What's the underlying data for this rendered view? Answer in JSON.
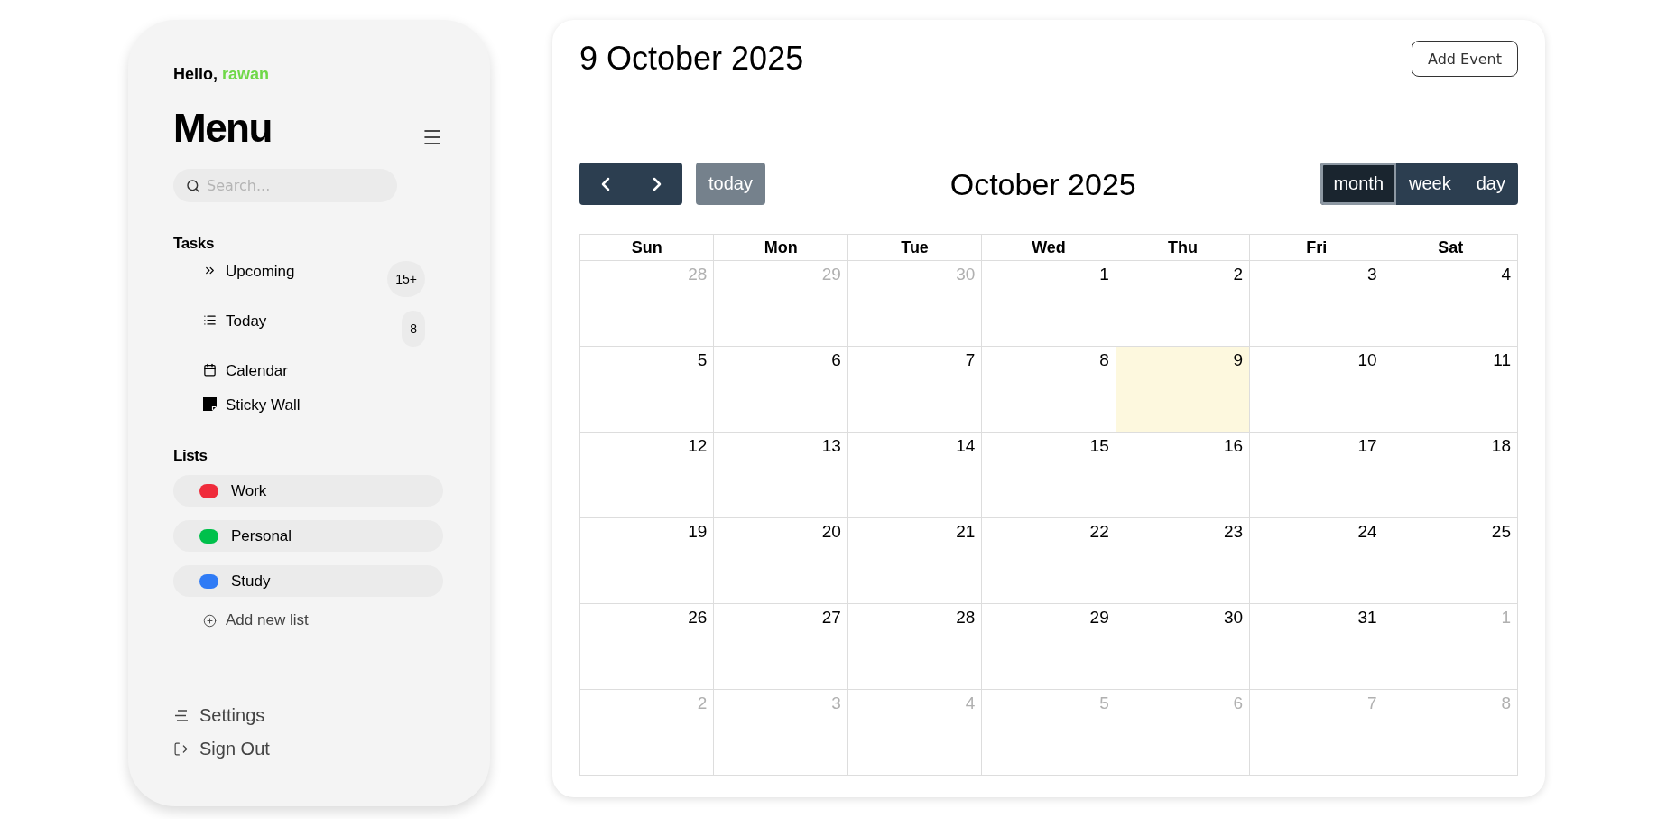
{
  "sidebar": {
    "greeting": {
      "text": "Hello,",
      "name": "rawan"
    },
    "title": "Menu",
    "search": {
      "placeholder": "Search..."
    },
    "tasks": {
      "heading": "Tasks",
      "items": [
        {
          "label": "Upcoming",
          "badge": "15+"
        },
        {
          "label": "Today",
          "badge": "8"
        },
        {
          "label": "Calendar"
        },
        {
          "label": "Sticky Wall"
        }
      ]
    },
    "lists": {
      "heading": "Lists",
      "items": [
        {
          "label": "Work",
          "color": "#ef2b3b"
        },
        {
          "label": "Personal",
          "color": "#00c04b"
        },
        {
          "label": "Study",
          "color": "#2f7bf5"
        }
      ],
      "add_label": "Add new list"
    },
    "footer": [
      {
        "label": "Settings"
      },
      {
        "label": "Sign Out"
      }
    ]
  },
  "header": {
    "date_title": "9 October 2025",
    "add_button": "Add Event"
  },
  "calendar": {
    "today_button": {
      "label": "today",
      "disabled": true
    },
    "title": "October 2025",
    "views": [
      {
        "label": "month",
        "selected": true
      },
      {
        "label": "week",
        "selected": false
      },
      {
        "label": "day",
        "selected": false
      }
    ],
    "weekdays": [
      "Sun",
      "Mon",
      "Tue",
      "Wed",
      "Thu",
      "Fri",
      "Sat"
    ],
    "weeks": [
      [
        {
          "day": "28",
          "outside_month": true,
          "is_today": false
        },
        {
          "day": "29",
          "outside_month": true,
          "is_today": false
        },
        {
          "day": "30",
          "outside_month": true,
          "is_today": false
        },
        {
          "day": "1",
          "outside_month": false,
          "is_today": false
        },
        {
          "day": "2",
          "outside_month": false,
          "is_today": false
        },
        {
          "day": "3",
          "outside_month": false,
          "is_today": false
        },
        {
          "day": "4",
          "outside_month": false,
          "is_today": false
        }
      ],
      [
        {
          "day": "5",
          "outside_month": false,
          "is_today": false
        },
        {
          "day": "6",
          "outside_month": false,
          "is_today": false
        },
        {
          "day": "7",
          "outside_month": false,
          "is_today": false
        },
        {
          "day": "8",
          "outside_month": false,
          "is_today": false
        },
        {
          "day": "9",
          "outside_month": false,
          "is_today": true
        },
        {
          "day": "10",
          "outside_month": false,
          "is_today": false
        },
        {
          "day": "11",
          "outside_month": false,
          "is_today": false
        }
      ],
      [
        {
          "day": "12",
          "outside_month": false,
          "is_today": false
        },
        {
          "day": "13",
          "outside_month": false,
          "is_today": false
        },
        {
          "day": "14",
          "outside_month": false,
          "is_today": false
        },
        {
          "day": "15",
          "outside_month": false,
          "is_today": false
        },
        {
          "day": "16",
          "outside_month": false,
          "is_today": false
        },
        {
          "day": "17",
          "outside_month": false,
          "is_today": false
        },
        {
          "day": "18",
          "outside_month": false,
          "is_today": false
        }
      ],
      [
        {
          "day": "19",
          "outside_month": false,
          "is_today": false
        },
        {
          "day": "20",
          "outside_month": false,
          "is_today": false
        },
        {
          "day": "21",
          "outside_month": false,
          "is_today": false
        },
        {
          "day": "22",
          "outside_month": false,
          "is_today": false
        },
        {
          "day": "23",
          "outside_month": false,
          "is_today": false
        },
        {
          "day": "24",
          "outside_month": false,
          "is_today": false
        },
        {
          "day": "25",
          "outside_month": false,
          "is_today": false
        }
      ],
      [
        {
          "day": "26",
          "outside_month": false,
          "is_today": false
        },
        {
          "day": "27",
          "outside_month": false,
          "is_today": false
        },
        {
          "day": "28",
          "outside_month": false,
          "is_today": false
        },
        {
          "day": "29",
          "outside_month": false,
          "is_today": false
        },
        {
          "day": "30",
          "outside_month": false,
          "is_today": false
        },
        {
          "day": "31",
          "outside_month": false,
          "is_today": false
        },
        {
          "day": "1",
          "outside_month": true,
          "is_today": false
        }
      ],
      [
        {
          "day": "2",
          "outside_month": true,
          "is_today": false
        },
        {
          "day": "3",
          "outside_month": true,
          "is_today": false
        },
        {
          "day": "4",
          "outside_month": true,
          "is_today": false
        },
        {
          "day": "5",
          "outside_month": true,
          "is_today": false
        },
        {
          "day": "6",
          "outside_month": true,
          "is_today": false
        },
        {
          "day": "7",
          "outside_month": true,
          "is_today": false
        },
        {
          "day": "8",
          "outside_month": true,
          "is_today": false
        }
      ]
    ]
  }
}
